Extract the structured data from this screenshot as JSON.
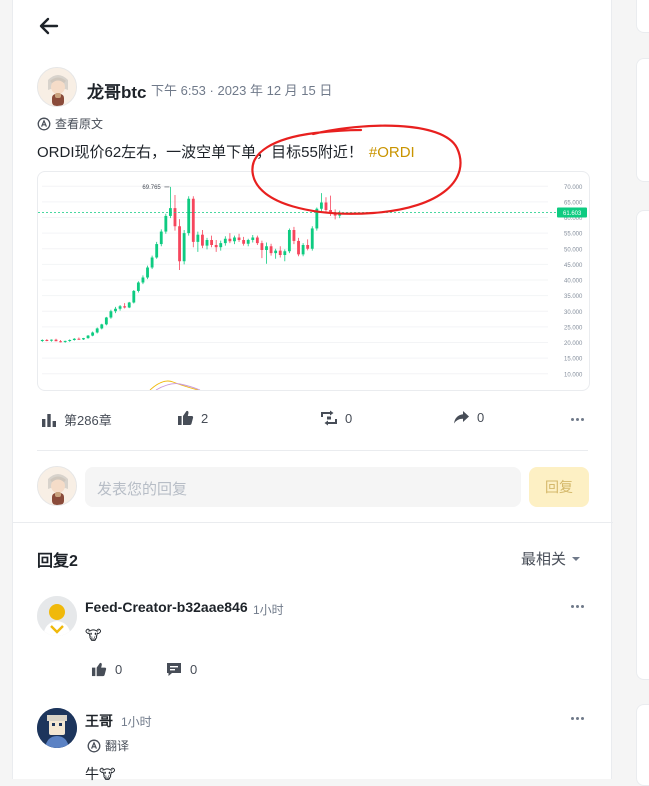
{
  "post": {
    "author": "龙哥btc",
    "time": "下午 6:53 · 2023 年 12 月 15 日",
    "translate_label": "查看原文",
    "text": "ORDI现价62左右，一波空单下单，目标55附近！",
    "hashtag": "#ORDI"
  },
  "chart_data": {
    "type": "candlestick",
    "ylim": [
      8,
      72
    ],
    "y_ticks": [
      "70.000",
      "65.000",
      "60.000",
      "55.000",
      "50.000",
      "45.000",
      "40.000",
      "35.000",
      "30.000",
      "25.000",
      "20.000",
      "15.000",
      "10.000"
    ],
    "y_tick_values": [
      70,
      65,
      60,
      55,
      50,
      45,
      40,
      35,
      30,
      25,
      20,
      15,
      10
    ],
    "high_label": "69.765",
    "high_value": 69.765,
    "current_price_label": "61.603",
    "current_price": 61.603,
    "colors": {
      "up": "#0ecb81",
      "down": "#f6465d",
      "price_line": "#0ecb81",
      "volume_a": "#f0b90b",
      "volume_b": "#c99ad8"
    },
    "candles": [
      [
        20.5,
        21.0,
        20.2,
        20.8
      ],
      [
        20.8,
        21.1,
        20.4,
        20.6
      ],
      [
        20.6,
        21.0,
        20.3,
        20.9
      ],
      [
        20.9,
        21.2,
        20.5,
        20.4
      ],
      [
        20.4,
        20.8,
        20.0,
        20.2
      ],
      [
        20.2,
        20.6,
        19.9,
        20.5
      ],
      [
        20.5,
        21.0,
        20.2,
        20.8
      ],
      [
        20.8,
        21.4,
        20.6,
        21.2
      ],
      [
        21.2,
        21.6,
        20.9,
        21.0
      ],
      [
        21.0,
        21.5,
        20.8,
        21.4
      ],
      [
        21.4,
        22.4,
        21.2,
        22.2
      ],
      [
        22.2,
        23.5,
        22.0,
        23.2
      ],
      [
        23.2,
        24.8,
        22.9,
        24.5
      ],
      [
        24.5,
        26.0,
        24.2,
        25.8
      ],
      [
        25.8,
        28.2,
        25.5,
        28.0
      ],
      [
        28.0,
        30.5,
        27.6,
        30.0
      ],
      [
        30.0,
        31.4,
        29.4,
        30.8
      ],
      [
        30.8,
        32.0,
        30.2,
        31.6
      ],
      [
        31.6,
        32.6,
        30.9,
        31.2
      ],
      [
        31.2,
        33.0,
        31.0,
        32.8
      ],
      [
        32.8,
        36.8,
        32.5,
        36.5
      ],
      [
        36.5,
        39.6,
        36.0,
        39.2
      ],
      [
        39.2,
        41.5,
        38.7,
        40.8
      ],
      [
        40.8,
        44.6,
        40.3,
        44.0
      ],
      [
        44.0,
        47.8,
        43.5,
        47.2
      ],
      [
        47.2,
        52.2,
        46.8,
        51.5
      ],
      [
        51.5,
        56.2,
        50.8,
        55.5
      ],
      [
        55.5,
        61.2,
        54.8,
        60.5
      ],
      [
        60.5,
        69.8,
        59.8,
        63.0
      ],
      [
        63.0,
        67.2,
        55.8,
        57.2
      ],
      [
        57.2,
        59.5,
        43.2,
        46.0
      ],
      [
        46.0,
        56.0,
        45.0,
        55.0
      ],
      [
        55.0,
        66.8,
        54.2,
        66.0
      ],
      [
        66.0,
        66.8,
        50.5,
        52.2
      ],
      [
        52.2,
        55.5,
        49.0,
        54.5
      ],
      [
        54.5,
        56.0,
        50.2,
        51.0
      ],
      [
        51.0,
        53.5,
        49.8,
        52.8
      ],
      [
        52.8,
        54.2,
        50.5,
        51.2
      ],
      [
        51.2,
        52.8,
        49.0,
        50.5
      ],
      [
        50.5,
        52.6,
        49.4,
        51.8
      ],
      [
        51.8,
        54.0,
        51.0,
        53.2
      ],
      [
        53.2,
        55.0,
        51.8,
        52.4
      ],
      [
        52.4,
        54.2,
        51.5,
        53.6
      ],
      [
        53.6,
        54.8,
        52.2,
        52.8
      ],
      [
        52.8,
        53.8,
        51.0,
        51.6
      ],
      [
        51.6,
        53.2,
        50.8,
        52.8
      ],
      [
        52.8,
        54.4,
        52.0,
        53.6
      ],
      [
        53.6,
        54.2,
        51.2,
        51.8
      ],
      [
        51.8,
        52.6,
        47.0,
        49.6
      ],
      [
        49.6,
        52.0,
        45.2,
        50.8
      ],
      [
        50.8,
        51.6,
        47.8,
        48.6
      ],
      [
        48.6,
        50.0,
        46.8,
        49.4
      ],
      [
        49.4,
        50.8,
        47.2,
        48.0
      ],
      [
        48.0,
        49.8,
        46.0,
        49.2
      ],
      [
        49.2,
        56.5,
        48.6,
        56.0
      ],
      [
        56.0,
        57.0,
        51.5,
        52.5
      ],
      [
        52.5,
        53.5,
        47.6,
        48.2
      ],
      [
        48.2,
        51.8,
        47.6,
        51.2
      ],
      [
        51.2,
        53.0,
        49.5,
        50.0
      ],
      [
        50.0,
        57.2,
        49.4,
        56.5
      ],
      [
        56.5,
        63.2,
        55.8,
        62.8
      ],
      [
        62.8,
        67.8,
        61.6,
        64.8
      ],
      [
        64.8,
        66.5,
        61.6,
        62.4
      ],
      [
        62.4,
        67.0,
        60.5,
        61.4
      ],
      [
        61.4,
        62.6,
        59.4,
        60.6
      ],
      [
        60.6,
        62.2,
        59.8,
        61.6
      ]
    ]
  },
  "actions": {
    "views": "第286章",
    "likes": "2",
    "reposts": "0",
    "shares": "0"
  },
  "composer": {
    "placeholder": "发表您的回复",
    "submit": "回复"
  },
  "replies": {
    "title": "回复2",
    "sort_label": "最相关",
    "items": [
      {
        "name": "Feed-Creator-b32aae846",
        "time": "1小时",
        "body": "🐮",
        "likes": "0",
        "comments": "0"
      },
      {
        "name": "王哥",
        "time": "1小时",
        "translate_label": "翻译",
        "body": "牛🐮"
      }
    ]
  }
}
